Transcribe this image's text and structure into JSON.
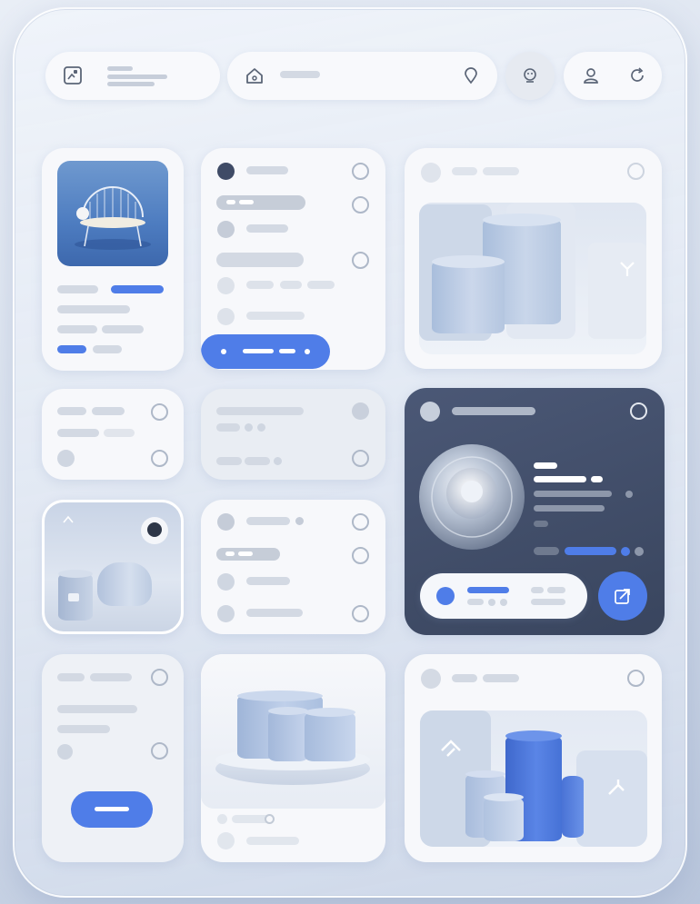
{
  "topbar": {
    "app_icon": "image-grid-icon",
    "home_icon": "home-icon",
    "location_icon": "location-pin-icon",
    "profile_center_icon": "face-icon",
    "user_icon": "user-icon",
    "refresh_icon": "refresh-icon"
  },
  "feature_card": {
    "icon": "share-arrow-icon"
  },
  "colors": {
    "accent": "#4f7de8",
    "dark_card": "#3d4a63",
    "light_card": "#f7f8fb",
    "placeholder": "#d3d9e3"
  }
}
